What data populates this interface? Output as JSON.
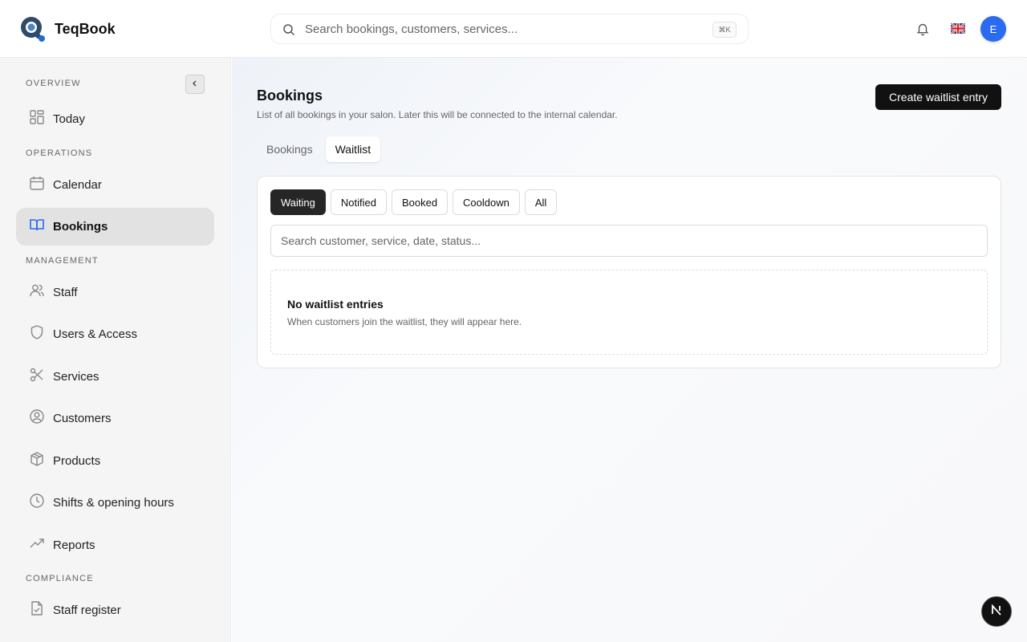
{
  "app": {
    "name": "TeqBook"
  },
  "header": {
    "search_placeholder": "Search bookings, customers, services...",
    "shortcut": "⌘K",
    "avatar_initial": "E"
  },
  "sidebar": {
    "sections": {
      "overview": "OVERVIEW",
      "operations": "OPERATIONS",
      "management": "MANAGEMENT",
      "compliance": "COMPLIANCE"
    },
    "items": {
      "today": "Today",
      "calendar": "Calendar",
      "bookings": "Bookings",
      "staff": "Staff",
      "users_access": "Users & Access",
      "services": "Services",
      "customers": "Customers",
      "products": "Products",
      "shifts": "Shifts & opening hours",
      "reports": "Reports",
      "staff_register": "Staff register"
    },
    "active_item": "Bookings"
  },
  "main": {
    "title": "Bookings",
    "subtitle": "List of all bookings in your salon. Later this will be connected to the internal calendar.",
    "create_button": "Create waitlist entry",
    "tabs": [
      "Bookings",
      "Waitlist"
    ],
    "active_tab": "Waitlist",
    "filters": [
      "Waiting",
      "Notified",
      "Booked",
      "Cooldown",
      "All"
    ],
    "active_filter": "Waiting",
    "search_placeholder": "Search customer, service, date, status...",
    "empty_title": "No waitlist entries",
    "empty_subtitle": "When customers join the waitlist, they will appear here."
  },
  "colors": {
    "accent": "#2b6bf0",
    "primary_button": "#111111",
    "sidebar_active": "#e2e2e2"
  }
}
